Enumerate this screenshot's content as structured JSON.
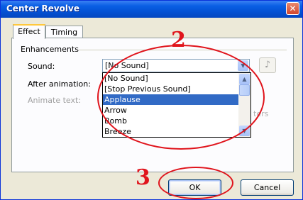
{
  "window": {
    "title": "Center Revolve",
    "close_glyph": "✕"
  },
  "tabs": [
    {
      "label": "Effect",
      "active": true
    },
    {
      "label": "Timing",
      "active": false
    }
  ],
  "enhancements": {
    "group_label": "Enhancements",
    "sound_label": "Sound:",
    "after_animation_label": "After animation:",
    "animate_text_label": "Animate text:",
    "partial_text": "ters"
  },
  "sound_combo": {
    "value": "[No Sound]",
    "options": [
      "[No Sound]",
      "[Stop Previous Sound]",
      "Applause",
      "Arrow",
      "Bomb",
      "Breeze"
    ],
    "selected": "Applause"
  },
  "icons": {
    "combo_arrow": "chevron-down-icon",
    "scroll_up": "chevron-up-icon",
    "scroll_down": "chevron-down-icon",
    "speaker": "speaker-icon",
    "close": "close-icon"
  },
  "buttons": {
    "ok": "OK",
    "cancel": "Cancel"
  },
  "annotations": [
    {
      "number": "2",
      "color": "#e0141c"
    },
    {
      "number": "3",
      "color": "#e0141c"
    }
  ],
  "colors": {
    "selection": "#316ac5",
    "titlebar": "#0453d6",
    "annotation": "#e0141c"
  }
}
